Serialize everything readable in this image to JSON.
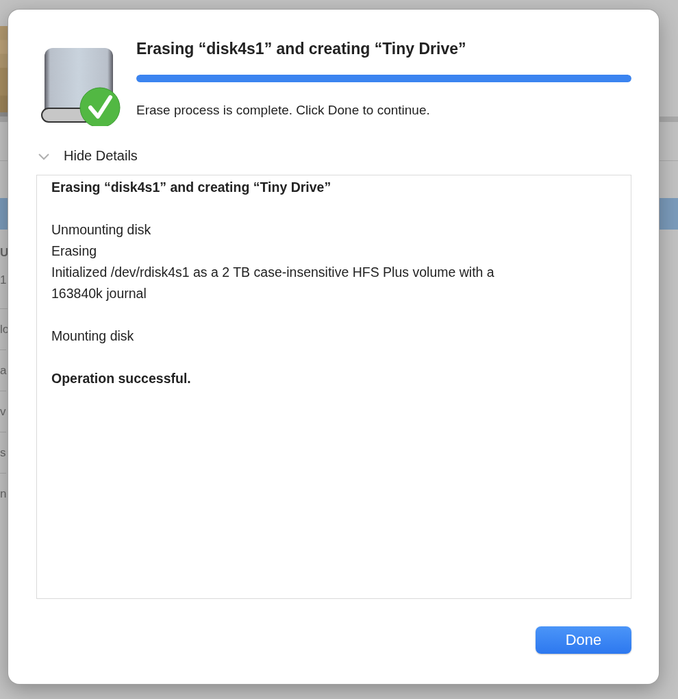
{
  "background": {
    "items": [
      {
        "text": "U",
        "kind": "bold"
      },
      {
        "text": "1",
        "kind": "normal"
      },
      {
        "text": "lo",
        "kind": "normal"
      },
      {
        "text": "a",
        "kind": "normal"
      },
      {
        "text": "v",
        "kind": "normal"
      },
      {
        "text": "s",
        "kind": "normal"
      },
      {
        "text": "n",
        "kind": "normal"
      }
    ]
  },
  "dialog": {
    "title": "Erasing “disk4s1” and creating “Tiny Drive”",
    "progress": {
      "level": 1
    },
    "status": "Erase process is complete. Click Done to continue.",
    "details_toggle": {
      "label": "Hide Details",
      "expanded": true
    },
    "log": [
      [
        {
          "text": "Erasing “disk4s1” and creating “Tiny Drive”",
          "kind": "bold"
        }
      ],
      [
        {
          "text": "Unmounting disk",
          "kind": "normal"
        },
        {
          "text": "Erasing",
          "kind": "normal"
        },
        {
          "text": "Initialized /dev/rdisk4s1 as a 2 TB case-insensitive HFS Plus volume with a 163840k journal",
          "kind": "normal"
        }
      ],
      [
        {
          "text": "Mounting disk",
          "kind": "normal"
        }
      ],
      [
        {
          "text": "Operation successful.",
          "kind": "bold"
        }
      ]
    ],
    "buttons": [
      "Done"
    ]
  }
}
